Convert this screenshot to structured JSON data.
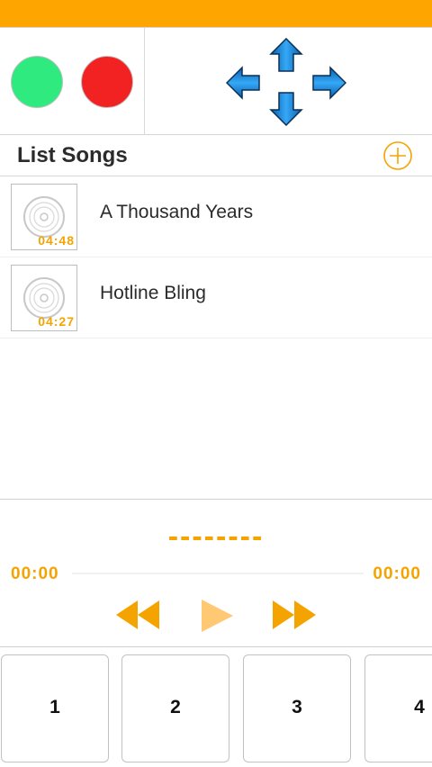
{
  "colors": {
    "accent": "#F5A300",
    "status_bar": "#FFA500",
    "green_button": "#2EEA7F",
    "red_button": "#F22222",
    "arrow_blue": "#1E90E8"
  },
  "controls": {
    "green_button_icon": "green-circle",
    "red_button_icon": "red-circle",
    "dpad_icons": [
      "arrow-up-icon",
      "arrow-down-icon",
      "arrow-left-icon",
      "arrow-right-icon"
    ]
  },
  "list": {
    "title": "List Songs",
    "add_icon": "plus-circle-icon",
    "songs": [
      {
        "title": "A Thousand Years",
        "duration": "04:48",
        "icon": "vinyl-disc-icon"
      },
      {
        "title": "Hotline Bling",
        "duration": "04:27",
        "icon": "vinyl-disc-icon"
      }
    ]
  },
  "player": {
    "now_playing": "--------",
    "current_time": "00:00",
    "total_time": "00:00",
    "progress": 0,
    "icons": [
      "rewind-icon",
      "play-icon",
      "fast-forward-icon"
    ]
  },
  "pads": [
    "1",
    "2",
    "3",
    "4"
  ]
}
